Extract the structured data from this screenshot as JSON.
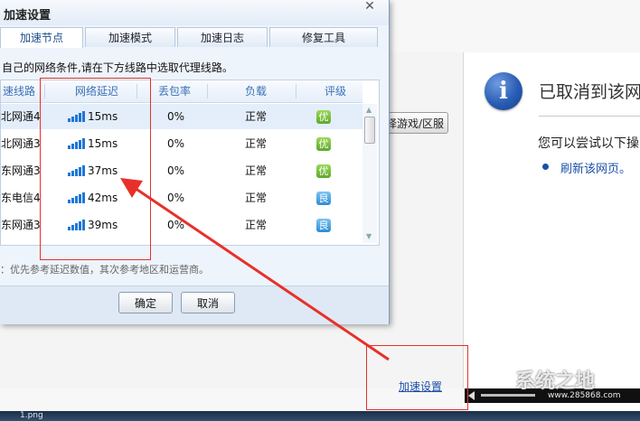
{
  "dialog": {
    "title": "加速设置",
    "close_glyph": "✕",
    "tabs": [
      "加速节点",
      "加速模式",
      "加速日志",
      "修复工具"
    ],
    "notice": "自己的网络条件,请在下方线路中选取代理线路。",
    "columns": [
      "速线路",
      "网络延迟",
      "丢包率",
      "负载",
      "评级"
    ],
    "rows": [
      {
        "line": "北网通4",
        "latency": "15ms",
        "loss": "0%",
        "load": "正常",
        "rating": "优",
        "rating_color": "#5ea82b"
      },
      {
        "line": "北网通3",
        "latency": "15ms",
        "loss": "0%",
        "load": "正常",
        "rating": "优",
        "rating_color": "#5ea82b"
      },
      {
        "line": "东网通3",
        "latency": "37ms",
        "loss": "0%",
        "load": "正常",
        "rating": "优",
        "rating_color": "#5ea82b"
      },
      {
        "line": "东电信4",
        "latency": "42ms",
        "loss": "0%",
        "load": "正常",
        "rating": "良",
        "rating_color": "#2f8bd3"
      },
      {
        "line": "东网通3",
        "latency": "39ms",
        "loss": "0%",
        "load": "正常",
        "rating": "良",
        "rating_color": "#2f8bd3"
      }
    ],
    "tip": "：优先参考延迟数值，其次参考地区和运营商。",
    "ok_label": "确定",
    "cancel_label": "取消"
  },
  "background": {
    "error_title": "已取消到该网页",
    "hint": "您可以尝试以下操",
    "refresh_link": "刷新该网页。",
    "game_button": "择游戏/区服",
    "accel_link": "加速设置",
    "taskbar_text": "1.png"
  },
  "watermark": {
    "text": "系统之地",
    "url": "www.285868.com"
  },
  "colors": {
    "annotation_red": "#e8302a",
    "link_blue": "#1d4fa8",
    "header_blue": "#3b72b6"
  }
}
